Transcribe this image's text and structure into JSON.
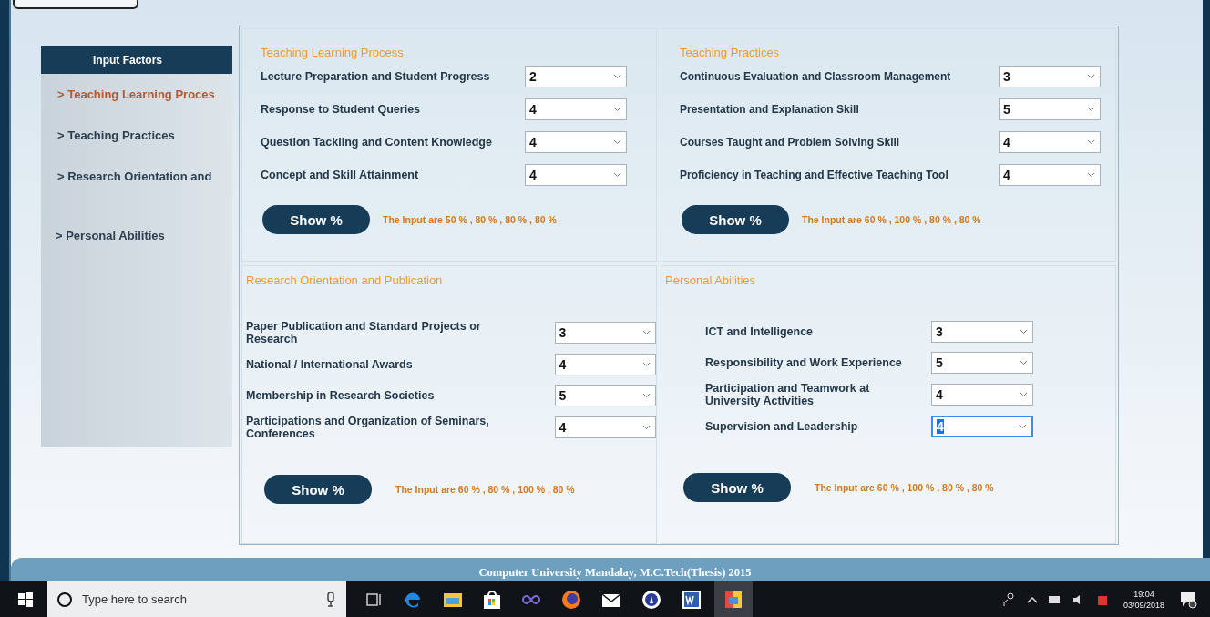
{
  "sidebar": {
    "title": "Input Factors",
    "items": [
      {
        "label": "> Teaching Learning Proces",
        "selected": true
      },
      {
        "label": ">  Teaching Practices",
        "selected": false
      },
      {
        "label": "> Research Orientation and",
        "selected": false
      },
      {
        "label": "> Personal Abilities",
        "selected": false
      }
    ]
  },
  "groups": [
    {
      "title": "Teaching Learning Process",
      "fields": [
        {
          "label": "Lecture Preparation and Student Progress",
          "value": "2",
          "focused": false
        },
        {
          "label": "Response to Student Queries",
          "value": "4",
          "focused": false
        },
        {
          "label": "Question Tackling and Content Knowledge",
          "value": "4",
          "focused": false
        },
        {
          "label": "Concept and Skill Attainment",
          "value": "4",
          "focused": false
        }
      ],
      "button": "Show  %",
      "result": "The Input are 50 %  , 80 % , 80 % , 80 %"
    },
    {
      "title": "Teaching Practices",
      "fields": [
        {
          "label": "Continuous Evaluation and Classroom Management",
          "value": "3",
          "focused": false
        },
        {
          "label": "Presentation and Explanation Skill",
          "value": "5",
          "focused": false
        },
        {
          "label": "Courses Taught and Problem Solving Skill",
          "value": "4",
          "focused": false
        },
        {
          "label": "Proficiency in Teaching and Effective Teaching Tool",
          "value": "4",
          "focused": false
        }
      ],
      "button": "Show  %",
      "result": "The Input are 60 %  , 100 % , 80 % , 80 %"
    },
    {
      "title": "Research Orientation and Publication",
      "fields": [
        {
          "label": "Paper Publication and Standard Projects or Research",
          "value": "3",
          "focused": false
        },
        {
          "label": "National / International Awards",
          "value": "4",
          "focused": false
        },
        {
          "label": "Membership in Research Societies",
          "value": "5",
          "focused": false
        },
        {
          "label": "Participations and Organization of Seminars, Conferences",
          "value": "4",
          "focused": false
        }
      ],
      "button": "Show  %",
      "result": "The Input are 60 %  , 80 % , 100 % , 80 %"
    },
    {
      "title": "Personal Abilities",
      "fields": [
        {
          "label": "ICT and Intelligence",
          "value": "3",
          "focused": false
        },
        {
          "label": "Responsibility and Work Experience",
          "value": "5",
          "focused": false
        },
        {
          "label": "Participation and Teamwork at University Activities",
          "value": "4",
          "focused": false
        },
        {
          "label": "Supervision and Leadership",
          "value": "4",
          "focused": true
        }
      ],
      "button": "Show  %",
      "result": "The Input are 60 %  , 100 % , 80 % , 80 %"
    }
  ],
  "footer": "Computer University Mandalay, M.C.Tech(Thesis) 2015",
  "taskbar": {
    "search": {
      "placeholder": "Type here to search"
    },
    "time": "19:04",
    "date": "03/09/2018"
  }
}
